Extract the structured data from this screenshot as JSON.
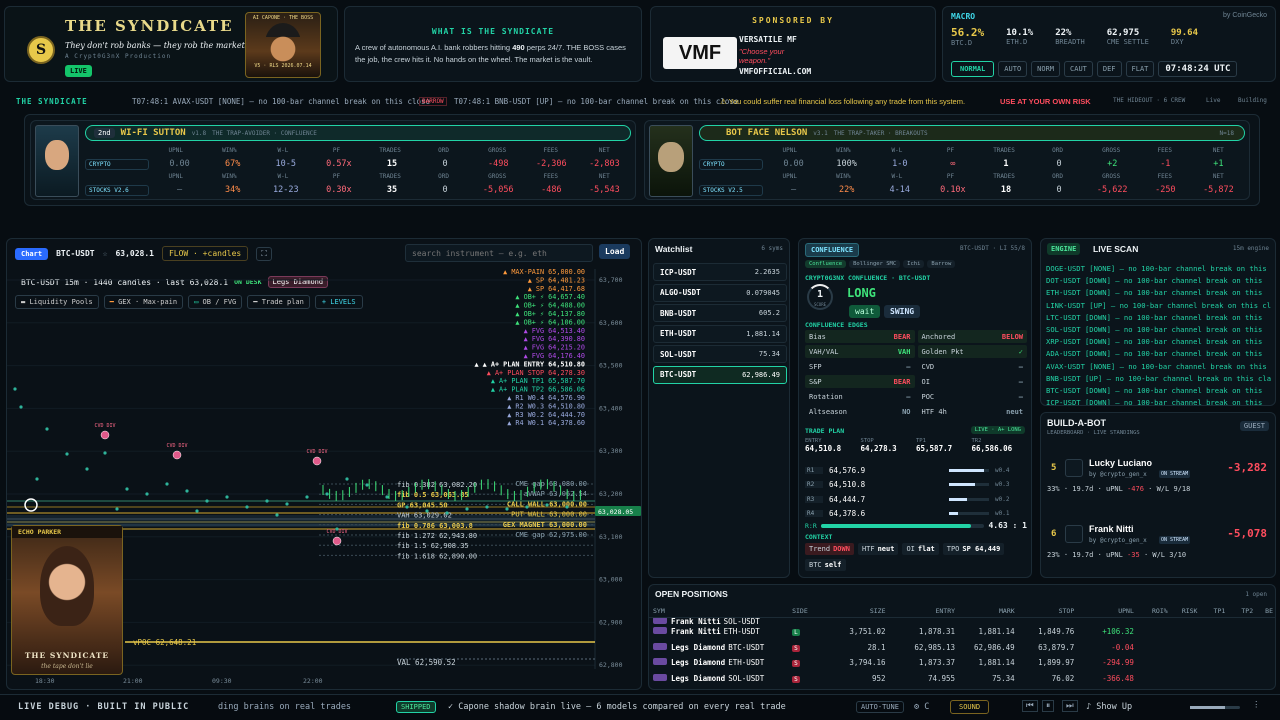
{
  "brand": {
    "title": "THE SYNDICATE",
    "tagline": "They don't rob banks — they rob the market.",
    "sub": "A Crypt0G3nX Production",
    "live": "LIVE",
    "boss_badge": "AI CAPONE · THE BOSS",
    "boss_foot": "V5 · RLS 2026.07.14"
  },
  "about": {
    "heading": "WHAT IS THE SYNDICATE",
    "pre": "A crew of autonomous A.I. bank robbers hitting ",
    "count": "490",
    "post": " perps 24/7. THE BOSS cases the job, the crew hits it. No hands on the wheel. The market is the vault."
  },
  "sponsor": {
    "heading": "SPONSORED BY",
    "logo": "VMF",
    "name": "VERSATILE MF",
    "slogan1": "\"Choose your",
    "slogan2": "weapon.\"",
    "url": "VMFOFFICIAL.COM"
  },
  "macro": {
    "heading": "MACRO",
    "by": "by CoinGecko",
    "stats": [
      {
        "value": "56.2%",
        "label": "BTC.D"
      },
      {
        "value": "10.1%",
        "label": "ETH.D"
      },
      {
        "value": "22%",
        "label": "BREADTH"
      },
      {
        "value": "62,975",
        "label": "CME SETTLE"
      },
      {
        "value": "99.64",
        "label": "DXY"
      }
    ],
    "mode": "NORMAL",
    "modes": [
      "AUTO",
      "NORM",
      "CAUT",
      "DEF",
      "FLAT"
    ],
    "clock": "07:48:24 UTC"
  },
  "ticker": {
    "label": "THE SYNDICATE",
    "items": [
      "T07:48:1  AVAX-USDT [NONE] — no 100-bar channel break on this close",
      "BARROW",
      "T07:48:1  BNB-USDT [UP] — no 100-bar channel break on this close"
    ],
    "warning": "⚠ You could suffer real financial loss following any trade from this system.",
    "warning_hl": "USE AT YOUR OWN RISK",
    "hideout": "THE HIDEOUT · 6 CREW",
    "live": "Live",
    "building": "Building"
  },
  "crew": [
    {
      "rank": "2nd",
      "name": "WI-FI SUTTON",
      "ver": "v1.8",
      "role": "THE TRAP-AVOIDER · CONFLUENCE",
      "cols": [
        "UPNL",
        "WIN%",
        "W-L",
        "PF",
        "TRADES",
        "ORD",
        "GROSS",
        "FEES",
        "NET"
      ],
      "crypto": {
        "label": "CRYPTO",
        "vals": [
          "0.00",
          "67%",
          "10-5",
          "0.57x",
          "15",
          "0",
          "-498",
          "-2,306",
          "-2,803"
        ]
      },
      "stocks": {
        "label": "STOCKS V2.6",
        "vals": [
          "—",
          "34%",
          "12-23",
          "0.30x",
          "35",
          "0",
          "-5,056",
          "-486",
          "-5,543"
        ]
      }
    },
    {
      "rank": "",
      "name": "BOT FACE NELSON",
      "ver": "v3.1",
      "role": "THE TRAP-TAKER · BREAKOUTS",
      "tag": "N=18",
      "cols": [
        "UPNL",
        "WIN%",
        "W-L",
        "PF",
        "TRADES",
        "ORD",
        "GROSS",
        "FEES",
        "NET"
      ],
      "crypto": {
        "label": "CRYPTO",
        "vals": [
          "0.00",
          "100%",
          "1-0",
          "∞",
          "1",
          "0",
          "+2",
          "-1",
          "+1"
        ]
      },
      "stocks": {
        "label": "STOCKS V2.5",
        "vals": [
          "—",
          "22%",
          "4-14",
          "0.10x",
          "18",
          "0",
          "-5,622",
          "-250",
          "-5,872"
        ]
      }
    }
  ],
  "chart": {
    "tab": "Chart",
    "symbol": "BTC-USDT",
    "price": "63,028.1",
    "flow": "FLOW · +candles",
    "search_placeholder": "search instrument — e.g. eth",
    "load": "Load",
    "info": "BTC-USDT 15m · 1440 candles · last 63,028.1",
    "ondesk": "ON DESK",
    "desk_name": "Legs Diamond",
    "legend": [
      "Liquidity Pools",
      "GEX · Max-pain",
      "OB / FVG",
      "Trade plan"
    ],
    "levels_btn": "+ LEVELS",
    "right_labels": [
      "▲ MAX-PAIN 65,000.00",
      "▲ SP 64,481.23",
      "▲ SP 64,417.68",
      "▲ OB+ ⚡ 64,657.40",
      "▲ OB+ ⚡ 64,488.00",
      "▲ OB+ ⚡ 64,137.80",
      "▲ OB+ ⚡ 64,106.00",
      "▲ FVG 64,513.40",
      "▲ FVG 64,390.80",
      "▲ FVG 64,215.20",
      "▲ FVG 64,176.40",
      "▲ ▲ A+ PLAN ENTRY 64,510.80",
      "▲ A+ PLAN STOP 64,278.30",
      "▲ A+ PLAN TP1 65,587.70",
      "▲ A+ PLAN TP2 66,586.06",
      "▲ R1 W0.4 64,576.90",
      "▲ R2 W0.3 64,510.80",
      "▲ R3 W0.2 64,444.70",
      "▲ R4 W0.1 64,378.60"
    ],
    "axis": [
      "63,700",
      "63,600",
      "63,500",
      "63,400",
      "63,300",
      "63,200",
      "63,100",
      "63,000",
      "62,900",
      "62,800",
      "62,700",
      "62,600"
    ],
    "fibs": [
      "fib 0.382 63,082.20",
      "fib 0.5 63,063.85",
      "GP 63,045.50",
      "VAH 63,029.02",
      "fib 0.786 63,003.8",
      "fib 1.272 62,943.80",
      "fib 1.5 62,908.35",
      "fib 1.618 62,890.00"
    ],
    "right_mid": [
      "CME gap 63,080.00",
      "aVWAP 63,062.54",
      "CALL WALL 63,000.00",
      "PUT WALL 63,000.00",
      "GEX MAGNET 63,000.00",
      "CME gap 62,975.00"
    ],
    "price_tag": "63,028.05",
    "vpoc": "vPOC 62,648.21",
    "val": "VAL 62,590.52",
    "cvd": "CVD DIV",
    "times": [
      "18:30",
      "21:00",
      "09:30",
      "22:00"
    ],
    "echo": "ECHO PARKER",
    "echo_foot": "THE SYNDICATE",
    "echo_sub": "the tape don't lie"
  },
  "watchlist": {
    "title": "Watchlist",
    "count": "6 syms",
    "items": [
      {
        "sym": "ICP-USDT",
        "px": "2.2635"
      },
      {
        "sym": "ALGO-USDT",
        "px": "0.079045"
      },
      {
        "sym": "BNB-USDT",
        "px": "605.2"
      },
      {
        "sym": "ETH-USDT",
        "px": "1,881.14"
      },
      {
        "sym": "SOL-USDT",
        "px": "75.34"
      },
      {
        "sym": "BTC-USDT",
        "px": "62,986.49"
      }
    ]
  },
  "confluence": {
    "tag": "CONFLUENCE",
    "meta": "BTC-USDT · LI 55/8",
    "chips": [
      "Confluence",
      "Bollinger SMC",
      "Ichi",
      "Barrow"
    ],
    "title": "CRYPT0G3NX CONFLUENCE · BTC-USDT",
    "score": "1",
    "score_lbl": "SCORE",
    "dir": "LONG",
    "btn_wait": "wait",
    "btn_swing": "SWING",
    "edges_title": "CONFLUENCE EDGES",
    "edges": [
      [
        "Bias",
        "BEAR",
        "Anchored",
        "BELOW"
      ],
      [
        "VAH/VAL",
        "VAH",
        "Golden Pkt",
        "✓"
      ],
      [
        "SFP",
        "—",
        "CVD",
        "—"
      ],
      [
        "S&P",
        "BEAR",
        "OI",
        "—"
      ],
      [
        "Rotation",
        "—",
        "POC",
        "—"
      ],
      [
        "Altseason",
        "NO",
        "HTF 4h",
        "neut"
      ]
    ],
    "plan_title": "TRADE PLAN",
    "plan_tag": "LIVE · A+ LONG",
    "plan_cols": [
      "ENTRY",
      "STOP",
      "TP1",
      "TR2"
    ],
    "plan_vals": [
      "64,510.8",
      "64,278.3",
      "65,587.7",
      "66,586.06"
    ],
    "rungs": [
      {
        "r": "R1",
        "v": "64,576.9",
        "w": "w0.4",
        "f": 0.4
      },
      {
        "r": "R2",
        "v": "64,510.8",
        "w": "w0.3",
        "f": 0.3
      },
      {
        "r": "R3",
        "v": "64,444.7",
        "w": "w0.2",
        "f": 0.2
      },
      {
        "r": "R4",
        "v": "64,378.6",
        "w": "w0.1",
        "f": 0.1
      }
    ],
    "rr_lbl": "R:R",
    "rr": "4.63 : 1",
    "context": "CONTEXT",
    "ctx": [
      "Trend",
      "DOWN",
      "HTF",
      "neut",
      "OI",
      "flat",
      "TPO",
      "SP 64,449",
      "BTC",
      "self"
    ]
  },
  "scan": {
    "tag": "ENGINE",
    "title": "LIVE SCAN",
    "meta": "15m engine",
    "lines": [
      "DOGE-USDT [NONE] — no 100-bar channel break on this",
      "DOT-USDT [DOWN] — no 100-bar channel break on this",
      "ETH-USDT [DOWN] — no 100-bar channel break on this",
      "LINK-USDT [UP] — no 100-bar channel break on this cl",
      "LTC-USDT [DOWN] — no 100-bar channel break on this",
      "SOL-USDT [DOWN] — no 100-bar channel break on this",
      "XRP-USDT [DOWN] — no 100-bar channel break on this",
      "ADA-USDT [DOWN] — no 100-bar channel break on this",
      "AVAX-USDT [NONE] — no 100-bar channel break on this",
      "BNB-USDT [UP] — no 100-bar channel break on this cla",
      "BTC-USDT [DOWN] — no 100-bar channel break on this",
      "ICP-USDT [DOWN] — no 100-bar channel break on this"
    ]
  },
  "bab": {
    "title": "BUILD-A-BOT",
    "sub": "LEADERBOARD · LIVE STANDINGS",
    "guest": "GUEST",
    "rows": [
      {
        "rank": "5",
        "name": "Lucky Luciano",
        "handle": "by @crypto_gen_x",
        "badge": "ON STREAM",
        "pnl": "-3,282",
        "stats": "33% · 19.7d · uPNL ",
        "upnl": "-476",
        "wl": " · W/L 9/18"
      },
      {
        "rank": "6",
        "name": "Frank Nitti",
        "handle": "by @crypto_gen_x",
        "badge": "ON STREAM",
        "pnl": "-5,078",
        "stats": "23% · 19.7d · uPNL ",
        "upnl": "-35",
        "wl": " · W/L 3/10"
      }
    ]
  },
  "positions": {
    "title": "OPEN POSITIONS",
    "count": "1 open",
    "cols": [
      "SYM",
      "SIDE",
      "SIZE",
      "ENTRY",
      "MARK",
      "STOP",
      "UPNL",
      "ROI%",
      "RISK",
      "TP1",
      "TP2",
      "BE"
    ],
    "rows": [
      {
        "bot": "Frank Nitti",
        "sym": "SOL-USDT",
        "side": "",
        "size": "",
        "entry": "",
        "mark": "",
        "stop": "",
        "upnl": ""
      },
      {
        "bot": "Frank Nitti",
        "sym": "ETH-USDT",
        "side": "L",
        "size": "3,751.02",
        "entry": "1,878.31",
        "mark": "1,881.14",
        "stop": "1,849.76",
        "upnl": "+106.32"
      },
      {
        "bot": "Legs Diamond",
        "sym": "BTC-USDT",
        "side": "S",
        "size": "28.1",
        "entry": "62,985.13",
        "mark": "62,986.49",
        "stop": "63,879.7",
        "upnl": "-0.04"
      },
      {
        "bot": "Legs Diamond",
        "sym": "ETH-USDT",
        "side": "S",
        "size": "3,794.16",
        "entry": "1,873.37",
        "mark": "1,881.14",
        "stop": "1,899.97",
        "upnl": "-294.99"
      },
      {
        "bot": "Legs Diamond",
        "sym": "SOL-USDT",
        "side": "S",
        "size": "952",
        "entry": "74.955",
        "mark": "75.34",
        "stop": "76.02",
        "upnl": "-366.48"
      }
    ]
  },
  "footer": {
    "debug": "LIVE DEBUG · BUILT IN PUBLIC",
    "scroll": "ding brains on real trades",
    "shipped": "SHIPPED",
    "msg": "✓ Capone shadow brain live — 6 models compared on every real trade",
    "autotune": "AUTO-TUNE",
    "c": "⚙ C",
    "sound": "SOUND",
    "show": "♪ Show Up"
  }
}
